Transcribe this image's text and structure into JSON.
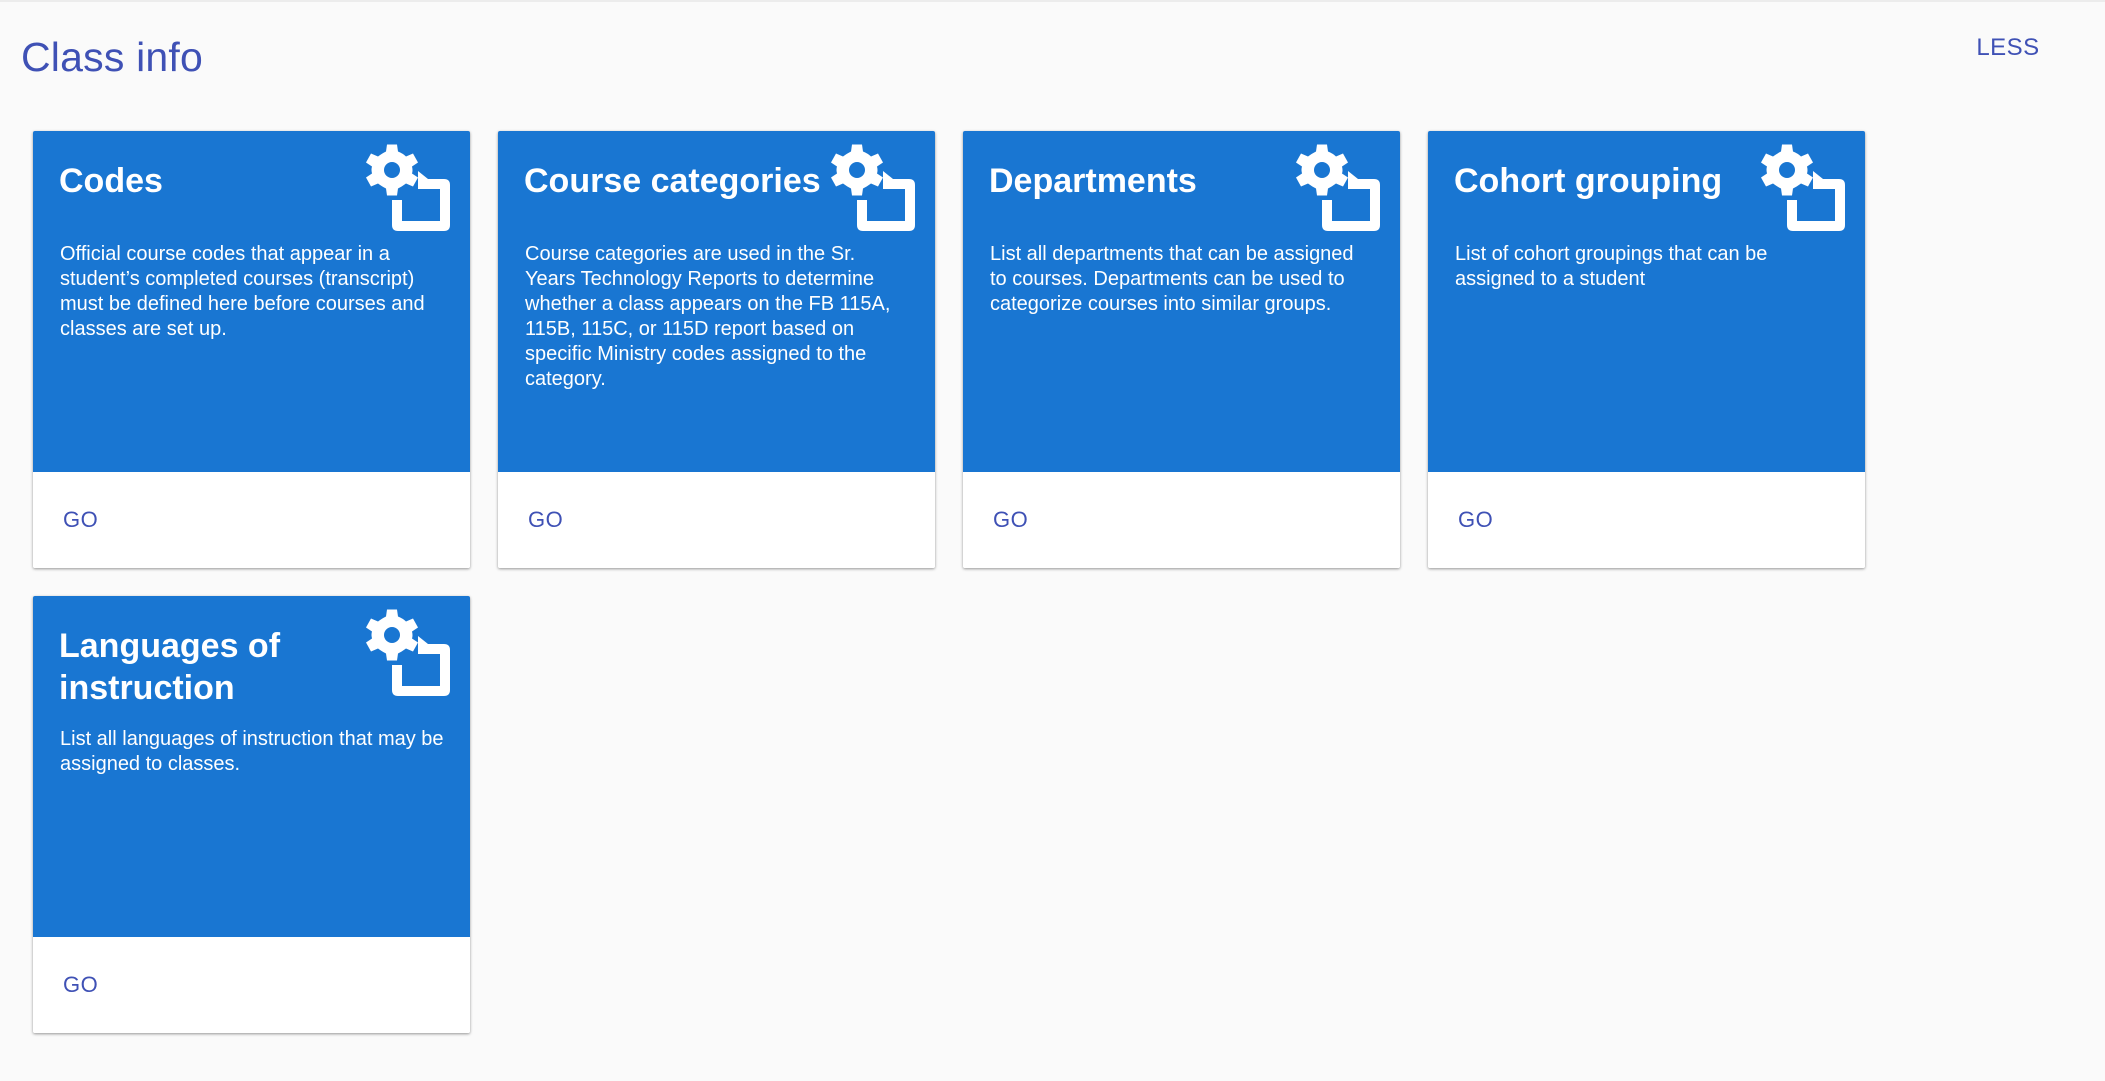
{
  "page": {
    "title": "Class info",
    "less_label": "LESS"
  },
  "colors": {
    "card_header_bg": "#1976d2",
    "accent_text": "#3f51b5",
    "page_bg": "#fafafa"
  },
  "cards": [
    {
      "title": "Codes",
      "description": "Official course codes that appear in a student’s completed courses (transcript) must be defined here before courses and classes are set up.",
      "icon": "settings-folder-icon",
      "action_label": "GO"
    },
    {
      "title": "Course categories",
      "description": "Course categories are used in the Sr. Years Technology Reports to determine whether a class appears on the FB 115A, 115B, 115C, or 115D report based on specific Ministry codes assigned to the category.",
      "icon": "settings-folder-icon",
      "action_label": "GO"
    },
    {
      "title": "Departments",
      "description": "List all departments that can be assigned to courses. Departments can be used to categorize courses into similar groups.",
      "icon": "settings-folder-icon",
      "action_label": "GO"
    },
    {
      "title": "Cohort grouping",
      "description": "List of cohort groupings that can be assigned to a student",
      "icon": "settings-folder-icon",
      "action_label": "GO"
    },
    {
      "title": "Languages of instruction",
      "description": "List all languages of instruction that may be assigned to classes.",
      "icon": "settings-folder-icon",
      "action_label": "GO"
    }
  ]
}
